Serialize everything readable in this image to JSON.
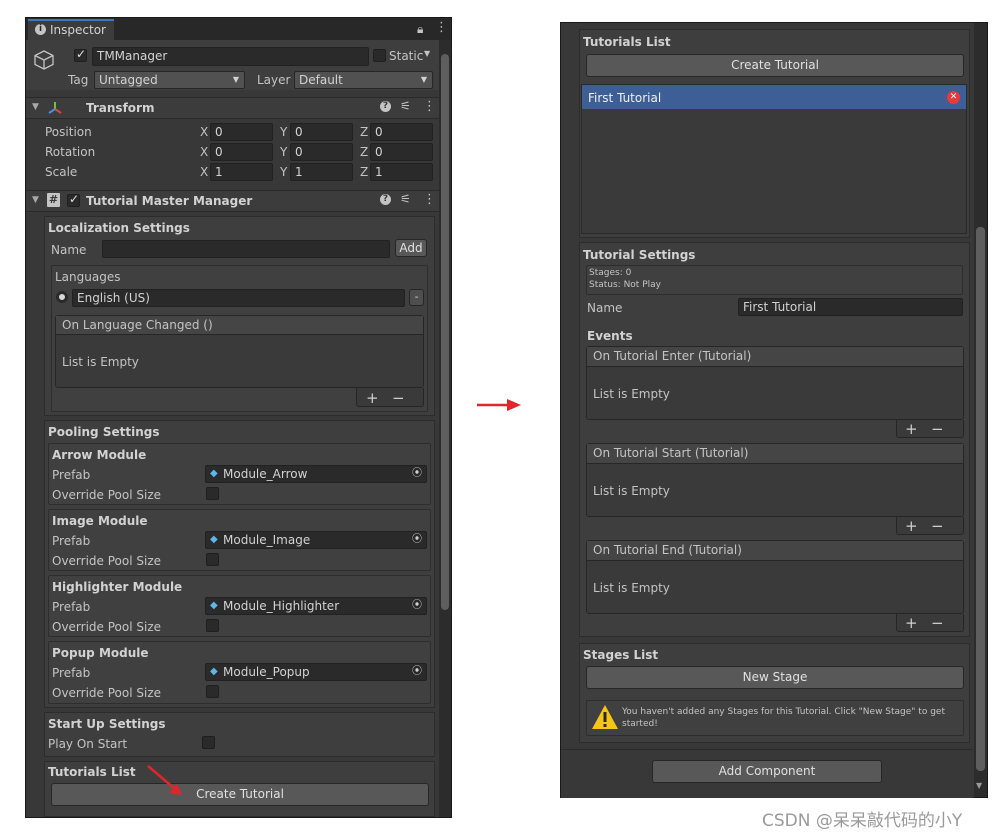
{
  "left": {
    "tab_label": "Inspector",
    "object_name": "TMManager",
    "static_label": "Static",
    "tag_label": "Tag",
    "tag_value": "Untagged",
    "layer_label": "Layer",
    "layer_value": "Default",
    "transform": {
      "title": "Transform",
      "rows": [
        {
          "label": "Position",
          "x": "0",
          "y": "0",
          "z": "0"
        },
        {
          "label": "Rotation",
          "x": "0",
          "y": "0",
          "z": "0"
        },
        {
          "label": "Scale",
          "x": "1",
          "y": "1",
          "z": "1"
        }
      ],
      "axis": {
        "x": "X",
        "y": "Y",
        "z": "Z"
      }
    },
    "manager_title": "Tutorial Master Manager",
    "localization": {
      "title": "Localization Settings",
      "name_label": "Name",
      "add_label": "Add",
      "languages_label": "Languages",
      "language": "English (US)",
      "remove_label": "-",
      "event_title": "On Language Changed ()",
      "empty": "List is Empty"
    },
    "pooling": {
      "title": "Pooling Settings",
      "prefab_label": "Prefab",
      "override_label": "Override Pool Size",
      "modules": [
        {
          "title": "Arrow Module",
          "prefab": "Module_Arrow"
        },
        {
          "title": "Image Module",
          "prefab": "Module_Image"
        },
        {
          "title": "Highlighter Module",
          "prefab": "Module_Highlighter"
        },
        {
          "title": "Popup Module",
          "prefab": "Module_Popup"
        }
      ]
    },
    "startup": {
      "title": "Start Up Settings",
      "play_label": "Play On Start"
    },
    "tutorials_list": {
      "title": "Tutorials List",
      "create_label": "Create Tutorial"
    }
  },
  "right": {
    "tutorials_list_title": "Tutorials List",
    "create_label": "Create Tutorial",
    "selected_tutorial": "First Tutorial",
    "settings": {
      "title": "Tutorial Settings",
      "stages": "Stages: 0",
      "status": "Status: Not Play",
      "name_label": "Name",
      "name_value": "First Tutorial",
      "events_label": "Events",
      "events": [
        {
          "title": "On Tutorial Enter (Tutorial)",
          "empty": "List is Empty"
        },
        {
          "title": "On Tutorial Start (Tutorial)",
          "empty": "List is Empty"
        },
        {
          "title": "On Tutorial End (Tutorial)",
          "empty": "List is Empty"
        }
      ]
    },
    "stages": {
      "title": "Stages List",
      "new_label": "New Stage",
      "warning": "You haven't added any Stages for this Tutorial. Click \"New Stage\" to get started!"
    },
    "add_component_label": "Add Component"
  },
  "footer_left": "CSDN @",
  "footer_right": "呆呆敲代码的小Y",
  "plus_label": "+",
  "minus_label": "−",
  "colors": {
    "panel_bg": "#383838",
    "selection": "#3e5f96",
    "arrow_red": "#e0262b",
    "warning_yellow": "#f5c518"
  }
}
